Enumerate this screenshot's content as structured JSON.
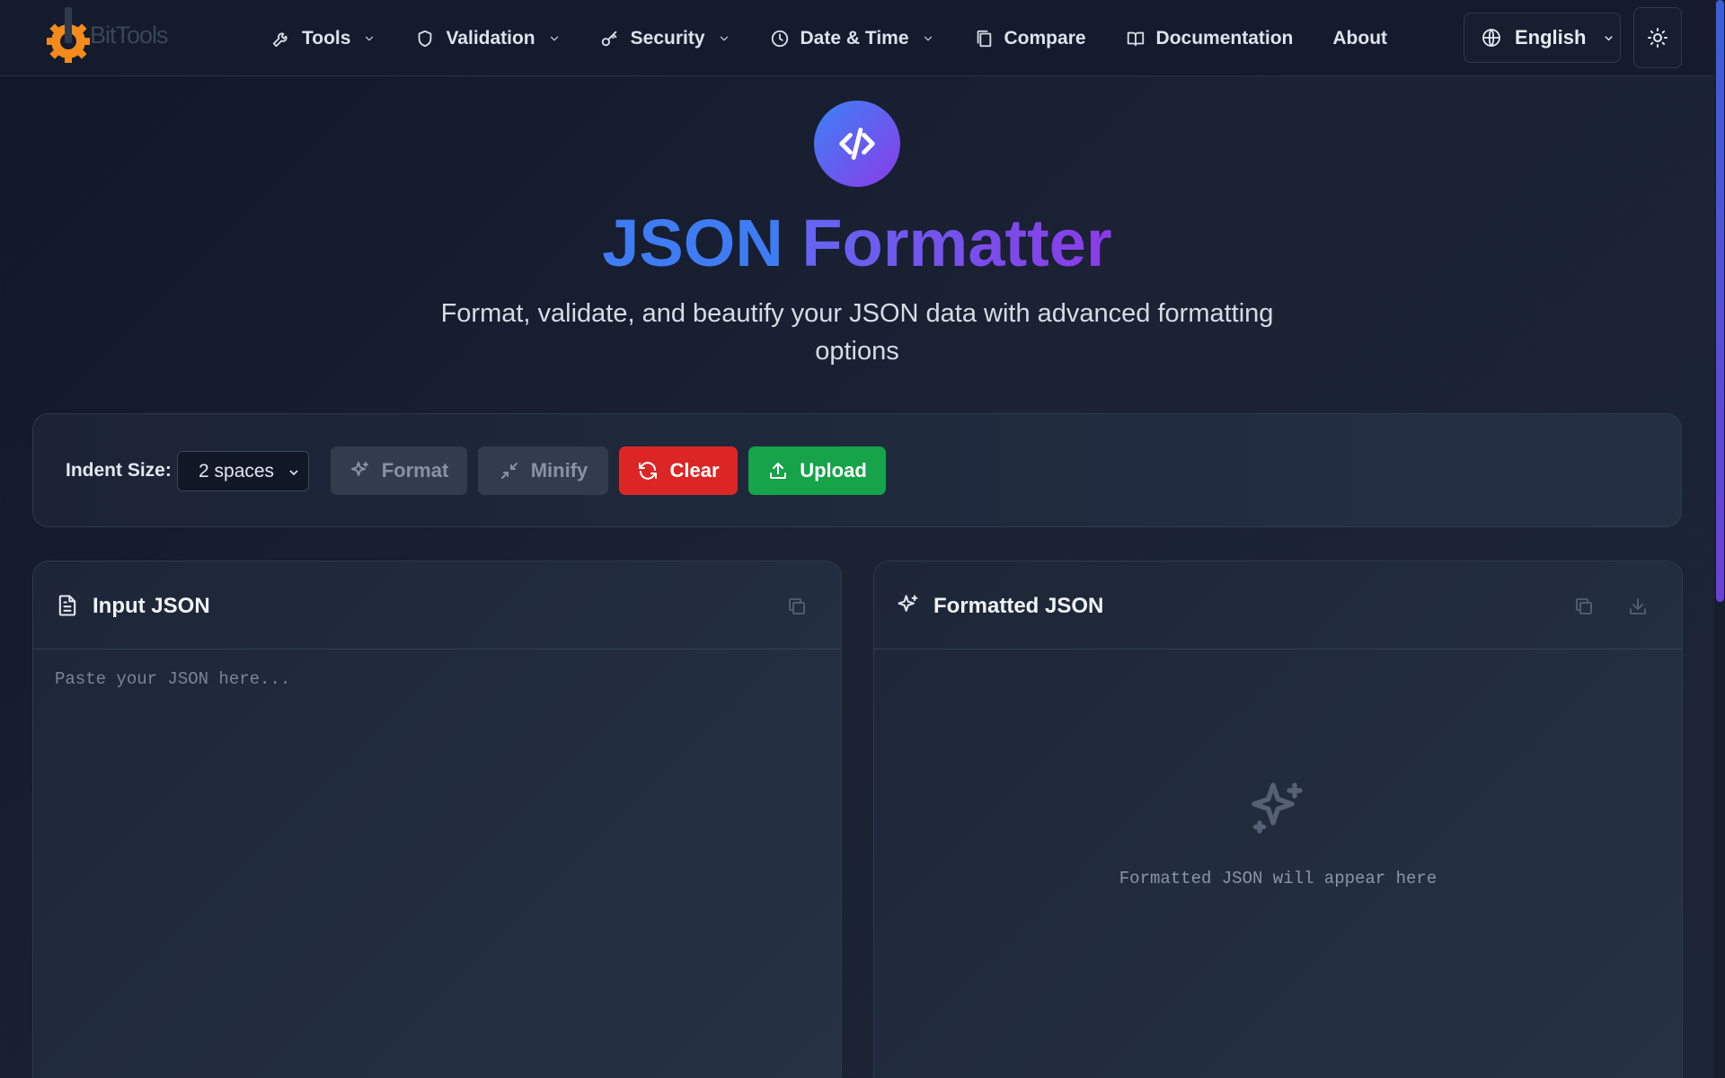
{
  "brand": {
    "name": "BitTools"
  },
  "nav": {
    "items": [
      {
        "label": "Tools",
        "icon": "wrench-icon",
        "dropdown": true
      },
      {
        "label": "Validation",
        "icon": "shield-icon",
        "dropdown": true
      },
      {
        "label": "Security",
        "icon": "key-icon",
        "dropdown": true
      },
      {
        "label": "Date & Time",
        "icon": "clock-icon",
        "dropdown": true
      },
      {
        "label": "Compare",
        "icon": "copy-files-icon",
        "dropdown": false
      },
      {
        "label": "Documentation",
        "icon": "book-icon",
        "dropdown": false
      },
      {
        "label": "About",
        "icon": "",
        "dropdown": false
      }
    ],
    "language": "English",
    "theme_icon": "sun-icon"
  },
  "hero": {
    "icon": "code-icon",
    "title_part1": "JSON",
    "title_part2": "Formatter",
    "subtitle": "Format, validate, and beautify your JSON data with advanced formatting options"
  },
  "toolbar": {
    "indent_label": "Indent Size:",
    "indent_value": "2 spaces",
    "format_label": "Format",
    "minify_label": "Minify",
    "clear_label": "Clear",
    "upload_label": "Upload"
  },
  "input_panel": {
    "title": "Input JSON",
    "placeholder": "Paste your JSON here..."
  },
  "output_panel": {
    "title": "Formatted JSON",
    "empty_text": "Formatted JSON will appear here"
  },
  "colors": {
    "accent_blue": "#3f7cf3",
    "accent_purple": "#8b3be8",
    "clear_red": "#dc2626",
    "upload_green": "#16a34a",
    "background": "#131b2c"
  }
}
